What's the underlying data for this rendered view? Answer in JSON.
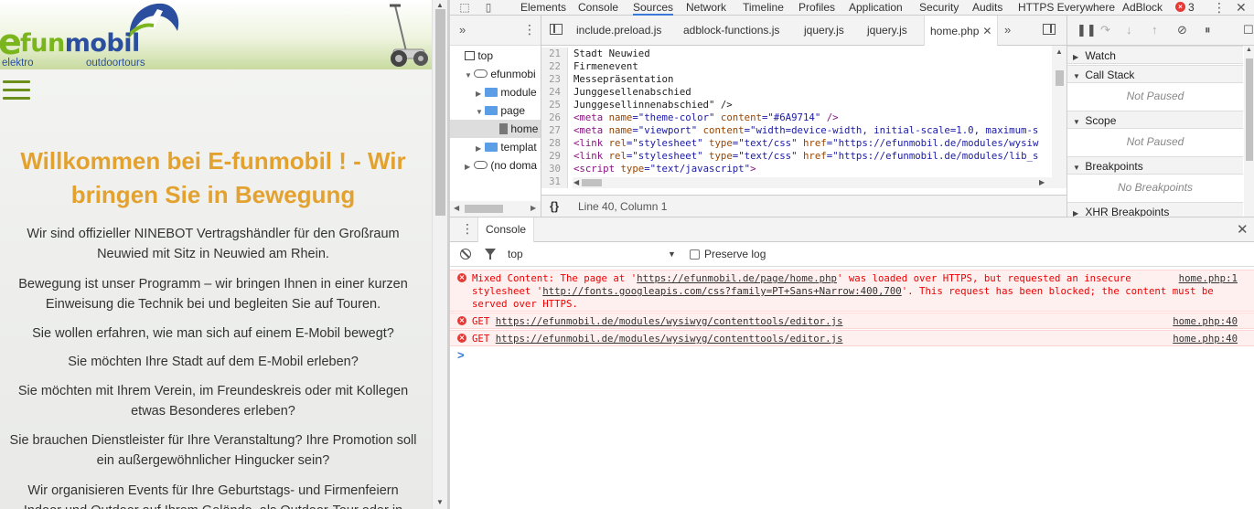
{
  "website": {
    "logo": {
      "e": "e",
      "fun": "fun",
      "mobil": "mobil",
      "sub_a": "elektro",
      "sub_b": "outdoortours"
    },
    "hero_title": "Willkommen bei E-funmobil ! - Wir bringen Sie in Bewegung",
    "paragraphs": [
      "Wir sind offizieller NINEBOT Vertragshändler für den Großraum Neuwied mit Sitz in Neuwied am Rhein.",
      "Bewegung ist unser Programm – wir bringen Ihnen in einer kurzen Einweisung die Technik bei und begleiten Sie auf Touren.",
      "Sie wollen erfahren, wie man sich auf einem E-Mobil bewegt?",
      "Sie möchten Ihre Stadt auf dem E-Mobil erleben?",
      "Sie möchten mit Ihrem Verein, im Freundeskreis oder mit Kollegen etwas Besonderes erleben?",
      "Sie brauchen Dienstleister für Ihre Veranstaltung? Ihre Promotion soll ein außergewöhnlicher Hingucker sein?",
      "Wir organisieren Events für Ihre Geburtstags- und Firmenfeiern Indoor und Outdoor auf Ihrem Gelände, als Outdoor-Tour oder in"
    ],
    "colors": {
      "title": "#e3a22f",
      "brand_green": "#7ab51d",
      "brand_blue": "#2b4f9e"
    }
  },
  "devtools": {
    "tabs": [
      "Elements",
      "Console",
      "Sources",
      "Network",
      "Timeline",
      "Profiles",
      "Application",
      "Security",
      "Audits",
      "HTTPS Everywhere",
      "AdBlock"
    ],
    "active_tab": "Sources",
    "error_count": "3",
    "navigator": {
      "items": [
        "top",
        "efunmobi",
        "module",
        "page",
        "home",
        "templat",
        "(no doma"
      ]
    },
    "editor": {
      "tabs": [
        "include.preload.js",
        "adblock-functions.js",
        "jquery.js",
        "jquery.js",
        "home.php"
      ],
      "active_tab": "home.php",
      "lines": [
        {
          "n": "21",
          "text": "Stadt Neuwied"
        },
        {
          "n": "22",
          "text": "Firmenevent"
        },
        {
          "n": "23",
          "text": "Messepräsentation"
        },
        {
          "n": "24",
          "text": "Junggesellenabschied"
        },
        {
          "n": "25",
          "text": "Junggesellinnenabschied\" />"
        },
        {
          "n": "26",
          "t1": "<meta ",
          "a1": "name",
          "v1": "=\"theme-color\" ",
          "a2": "content",
          "v2": "=\"#6A9714\" ",
          "t2": "/>"
        },
        {
          "n": "27",
          "t1": "<meta ",
          "a1": "name",
          "v1": "=\"viewport\" ",
          "a2": "content",
          "v2": "=\"width=device-width, initial-scale=1.0, maximum-s"
        },
        {
          "n": "28",
          "t1": "<link ",
          "a1": "rel",
          "v1": "=\"stylesheet\" ",
          "a2": "type",
          "v2": "=\"text/css\" ",
          "a3": "href",
          "v3": "=\"https://efunmobil.de/modules/wysiw"
        },
        {
          "n": "29",
          "t1": "<link ",
          "a1": "rel",
          "v1": "=\"stylesheet\" ",
          "a2": "type",
          "v2": "=\"text/css\" ",
          "a3": "href",
          "v3": "=\"https://efunmobil.de/modules/lib_s"
        },
        {
          "n": "30",
          "t1": "<script ",
          "a1": "type",
          "v1": "=\"text/javascript\"",
          "t2": ">"
        },
        {
          "n": "31",
          "text": ""
        }
      ],
      "status": "Line 40, Column 1",
      "braces": "{}"
    },
    "debugger": {
      "panes": [
        {
          "title": "Watch",
          "empty": ""
        },
        {
          "title": "Call Stack",
          "empty": "Not Paused"
        },
        {
          "title": "Scope",
          "empty": "Not Paused"
        },
        {
          "title": "Breakpoints",
          "empty": "No Breakpoints"
        },
        {
          "title": "XHR Breakpoints",
          "empty": ""
        }
      ]
    },
    "console": {
      "tab": "Console",
      "context": "top",
      "preserve_log": "Preserve log",
      "messages": [
        {
          "pre": "Mixed Content: The page at '",
          "url1": "https://efunmobil.de/page/home.php",
          "mid": "' was loaded over HTTPS, but requested an insecure\nstylesheet '",
          "url2": "http://fonts.googleapis.com/css?family=PT+Sans+Narrow:400,700",
          "post": "'. This request has been blocked; the content must be\nserved over HTTPS.",
          "source": "home.php:1"
        },
        {
          "pre": "GET ",
          "url1": "https://efunmobil.de/modules/wysiwyg/contenttools/editor.js",
          "source": "home.php:40"
        },
        {
          "pre": "GET ",
          "url1": "https://efunmobil.de/modules/wysiwyg/contenttools/editor.js",
          "source": "home.php:40"
        }
      ],
      "prompt": ">"
    }
  }
}
